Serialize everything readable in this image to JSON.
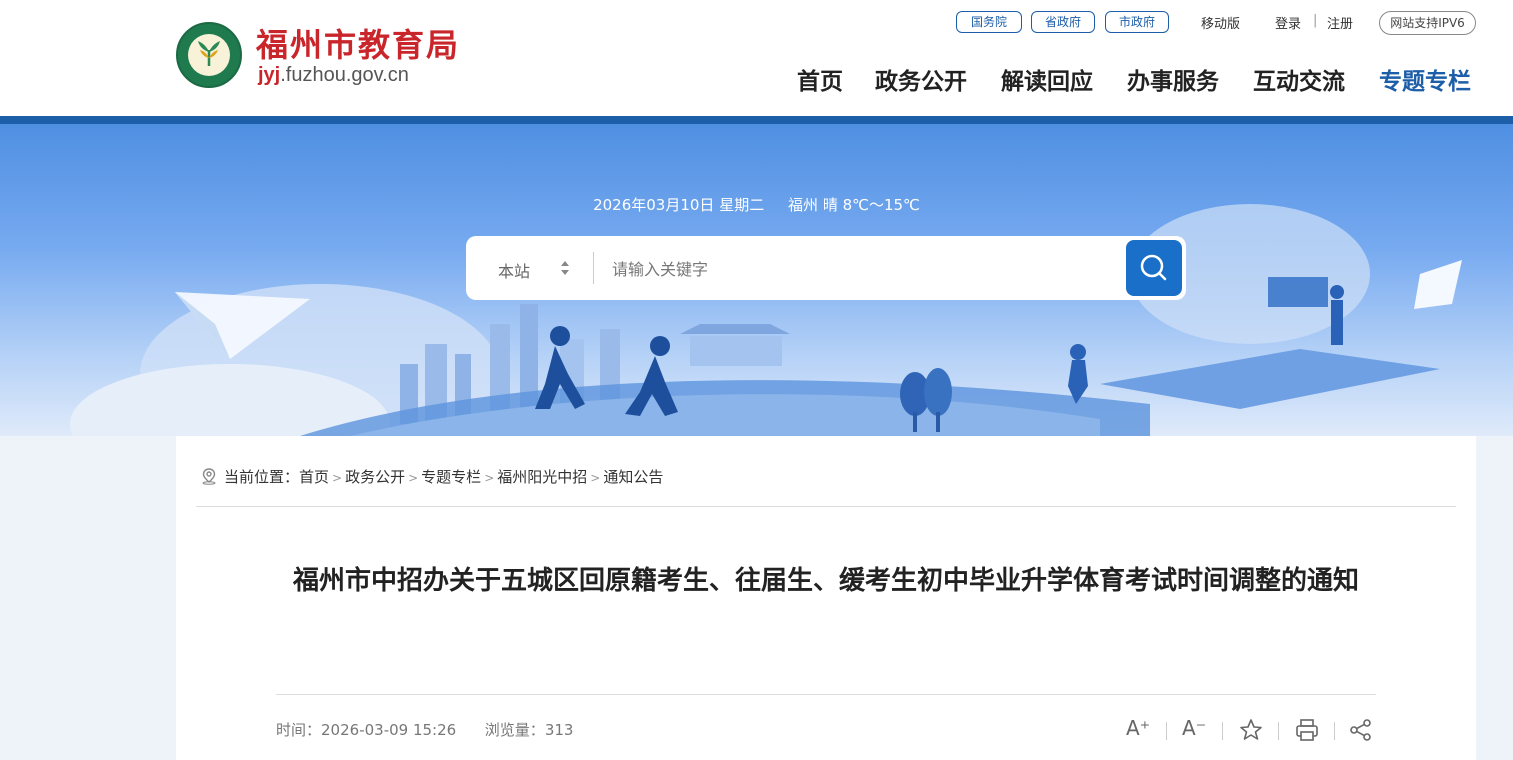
{
  "site": {
    "title": "福州市教育局",
    "domain_prefix": "jyj",
    "domain_rest": ".fuzhou.gov.cn",
    "brand_red": "#c9262b",
    "brand_blue": "#1d5ea8"
  },
  "top_links": {
    "pills": [
      "国务院",
      "省政府",
      "市政府"
    ],
    "mobile": "移动版",
    "login": "登录",
    "separator": "|",
    "register": "注册",
    "ipv6": "网站支持IPV6"
  },
  "nav": {
    "items": [
      "首页",
      "政务公开",
      "解读回应",
      "办事服务",
      "互动交流",
      "专题专栏"
    ],
    "active_index": 5
  },
  "banner": {
    "date_text": "2026年03月10日 星期二",
    "weather_text": "福州 晴 8℃～15℃"
  },
  "search": {
    "scope": "本站",
    "placeholder": "请输入关键字",
    "button_icon": "search-icon"
  },
  "breadcrumb": {
    "label": "当前位置：",
    "items": [
      "首页",
      "政务公开",
      "专题专栏",
      "福州阳光中招",
      "通知公告"
    ],
    "separator": ">"
  },
  "article": {
    "title": "福州市中招办关于五城区回原籍考生、往届生、缓考生初中毕业升学体育考试时间调整的通知",
    "time_label": "时间：",
    "time_value": "2026-03-09 15:26",
    "views_label": "浏览量：",
    "views_value": "313"
  },
  "tools": {
    "font_increase": "A⁺",
    "font_decrease": "A⁻",
    "icons": [
      "font-increase-icon",
      "font-decrease-icon",
      "star-icon",
      "print-icon",
      "share-icon"
    ]
  }
}
